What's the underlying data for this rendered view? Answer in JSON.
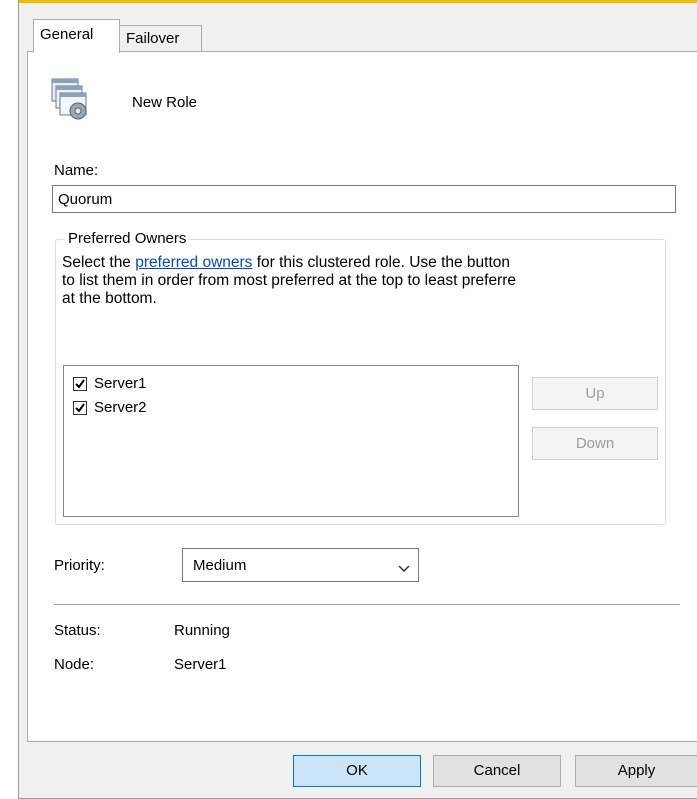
{
  "tabs": [
    {
      "label": "General",
      "active": true
    },
    {
      "label": "Failover",
      "active": false
    }
  ],
  "role": {
    "title": "New Role",
    "icon": "cluster-role-icon"
  },
  "name_field": {
    "label": "Name:",
    "value": "Quorum"
  },
  "preferred_owners": {
    "legend": "Preferred Owners",
    "desc_before": "Select the ",
    "desc_link": "preferred owners",
    "desc_after": " for this clustered role. Use the button",
    "desc_line2": "to list them in order from most preferred at the top to least preferre",
    "desc_line3": "at the bottom.",
    "owners": [
      {
        "name": "Server1",
        "checked": true
      },
      {
        "name": "Server2",
        "checked": true
      }
    ],
    "up_label": "Up",
    "down_label": "Down"
  },
  "priority": {
    "label": "Priority:",
    "value": "Medium"
  },
  "status": {
    "label": "Status:",
    "value": "Running"
  },
  "node": {
    "label": "Node:",
    "value": "Server1"
  },
  "buttons": {
    "ok": "OK",
    "cancel": "Cancel",
    "apply": "Apply"
  },
  "colors": {
    "accent_border": "#f5b800",
    "link": "#0645c8",
    "ok_button": "#cce4f7"
  }
}
